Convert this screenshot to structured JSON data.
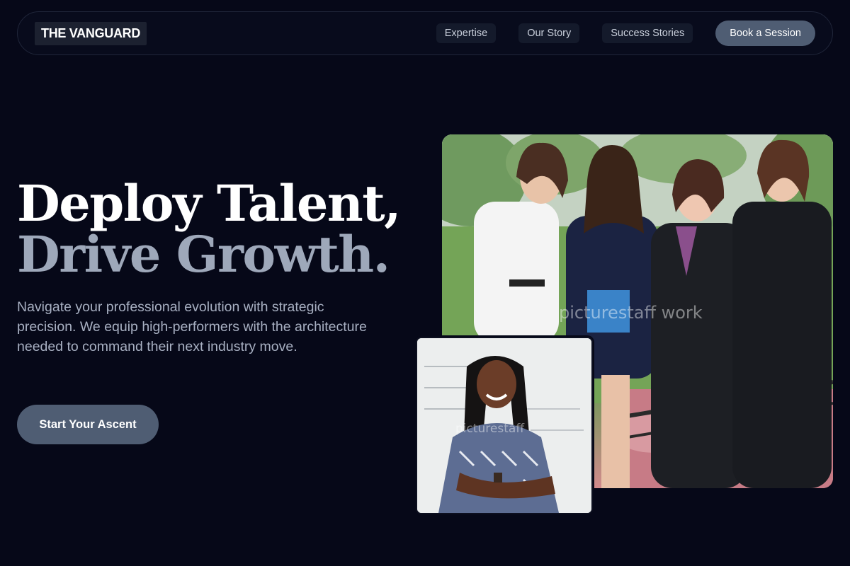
{
  "nav": {
    "logo": "THE VANGUARD",
    "links": [
      "Expertise",
      "Our Story",
      "Success Stories"
    ],
    "cta": "Book a Session"
  },
  "hero": {
    "headline_line1": "Deploy Talent,",
    "headline_line2": "Drive Growth.",
    "lead": "Navigate your professional evolution with strategic precision. We equip high-performers with the architecture needed to command their next industry move.",
    "cta": "Start Your Ascent"
  },
  "images": {
    "main_watermark": "picturestaff work",
    "small_watermark": "picturestaff"
  },
  "colors": {
    "background": "#060818",
    "button": "#4f5d73",
    "headline_accent": "#9ea8ba"
  }
}
